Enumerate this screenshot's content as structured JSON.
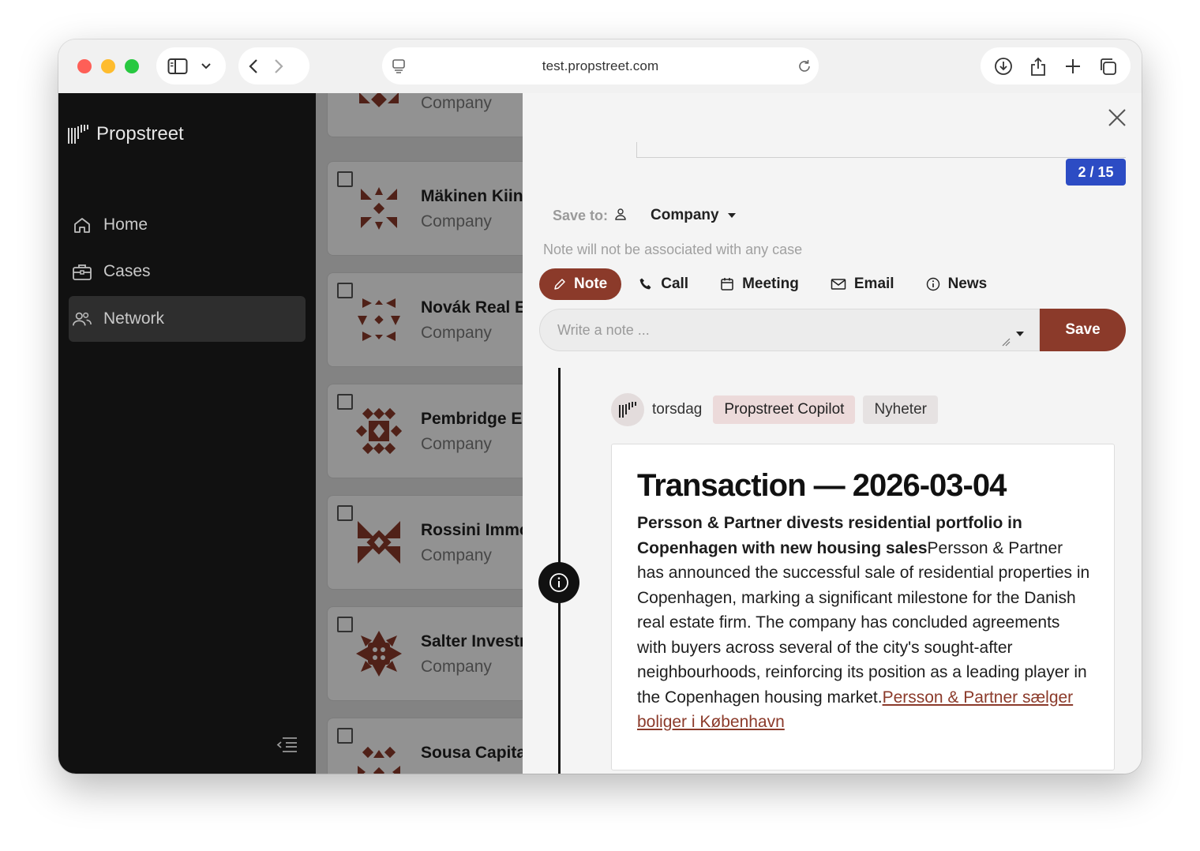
{
  "browser": {
    "url": "test.propstreet.com"
  },
  "sidebar": {
    "brand": "Propstreet",
    "items": [
      {
        "label": "Home",
        "icon": "home-icon"
      },
      {
        "label": "Cases",
        "icon": "briefcase-icon"
      },
      {
        "label": "Network",
        "icon": "users-icon",
        "active": true
      }
    ]
  },
  "list": {
    "cards": [
      {
        "name": "",
        "type": "Company"
      },
      {
        "name": "Mäkinen Kiin",
        "type": "Company"
      },
      {
        "name": "Novák Real E",
        "type": "Company"
      },
      {
        "name": "Pembridge E",
        "type": "Company"
      },
      {
        "name": "Rossini Immo",
        "type": "Company"
      },
      {
        "name": "Salter Investr",
        "type": "Company"
      },
      {
        "name": "Sousa Capita",
        "type": ""
      }
    ]
  },
  "panel": {
    "counter": "2 / 15",
    "save_to_label": "Save to:",
    "save_to_value": "Company",
    "hint": "Note will not be associated with any case",
    "tabs": [
      {
        "label": "Note",
        "icon": "pencil-icon",
        "active": true
      },
      {
        "label": "Call",
        "icon": "phone-icon"
      },
      {
        "label": "Meeting",
        "icon": "calendar-icon"
      },
      {
        "label": "Email",
        "icon": "mail-icon"
      },
      {
        "label": "News",
        "icon": "info-icon"
      }
    ],
    "composer_placeholder": "Write a note ...",
    "save_label": "Save",
    "entry": {
      "day": "torsdag",
      "chips": [
        "Propstreet Copilot",
        "Nyheter"
      ],
      "title": "Transaction — 2026-03-04",
      "lead": "Persson & Partner divests residential portfolio in Copenhagen with new housing sales",
      "body": "Persson & Partner has announced the successful sale of residential properties in Copenhagen, marking a significant milestone for the Danish real estate firm. The company has concluded agreements with buyers across several of the city's sought-after neighbourhoods, reinforcing its position as a leading player in the Copenhagen housing market.",
      "link": "Persson & Partner sælger boliger i København"
    }
  },
  "colors": {
    "accent": "#8b3a2a",
    "counter_bg": "#2c4cc4",
    "sidebar_bg": "#111111"
  }
}
